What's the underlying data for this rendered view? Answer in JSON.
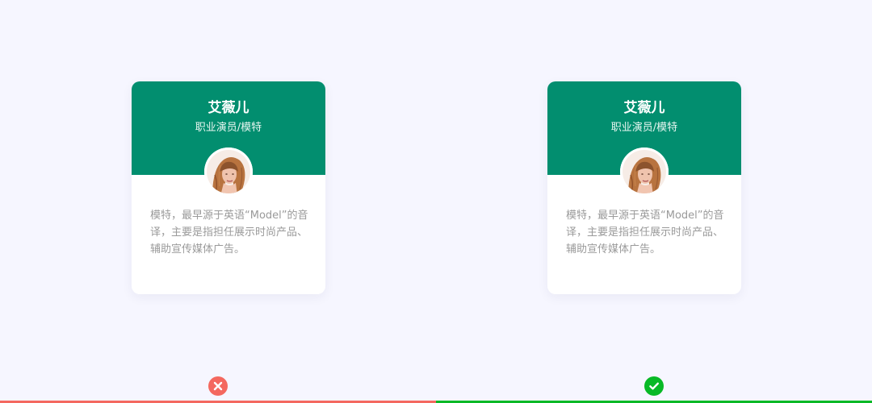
{
  "cards": [
    {
      "name": "艾薇儿",
      "role": "职业演员/模特",
      "description": "模特，最早源于英语“Model”的音译，主要是指担任展示时尚产品、辅助宣传媒体广告。"
    },
    {
      "name": "艾薇儿",
      "role": "职业演员/模特",
      "description": "模特，最早源于英语“Model”的音译，主要是指担任展示时尚产品、辅助宣传媒体广告。"
    }
  ],
  "icons": {
    "left_indicator": "close-circle-icon",
    "right_indicator": "check-circle-icon"
  },
  "colors": {
    "background": "#f6f6ff",
    "header_green": "#028e6f",
    "description_text": "#9a9a9a",
    "bad": "#f4685f",
    "good": "#08b926"
  }
}
